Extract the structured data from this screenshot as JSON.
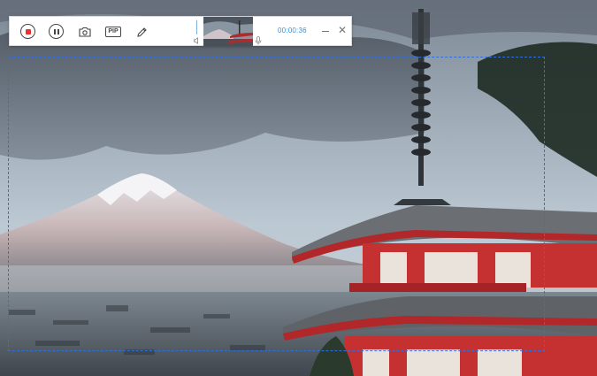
{
  "toolbar": {
    "stop_icon": "stop-record-icon",
    "pause_icon": "pause-icon",
    "camera_icon": "camera-icon",
    "pip_label": "PIP",
    "pen_icon": "pen-icon",
    "timer": "00:00:36",
    "close_label": "✕",
    "accent_color": "#3b8fd9",
    "stop_color": "#e8332e"
  },
  "capture_region": {
    "border_color": "#2f6fe0",
    "style": "dashed"
  },
  "annotation": {
    "arrow_color": "#e8332e"
  }
}
